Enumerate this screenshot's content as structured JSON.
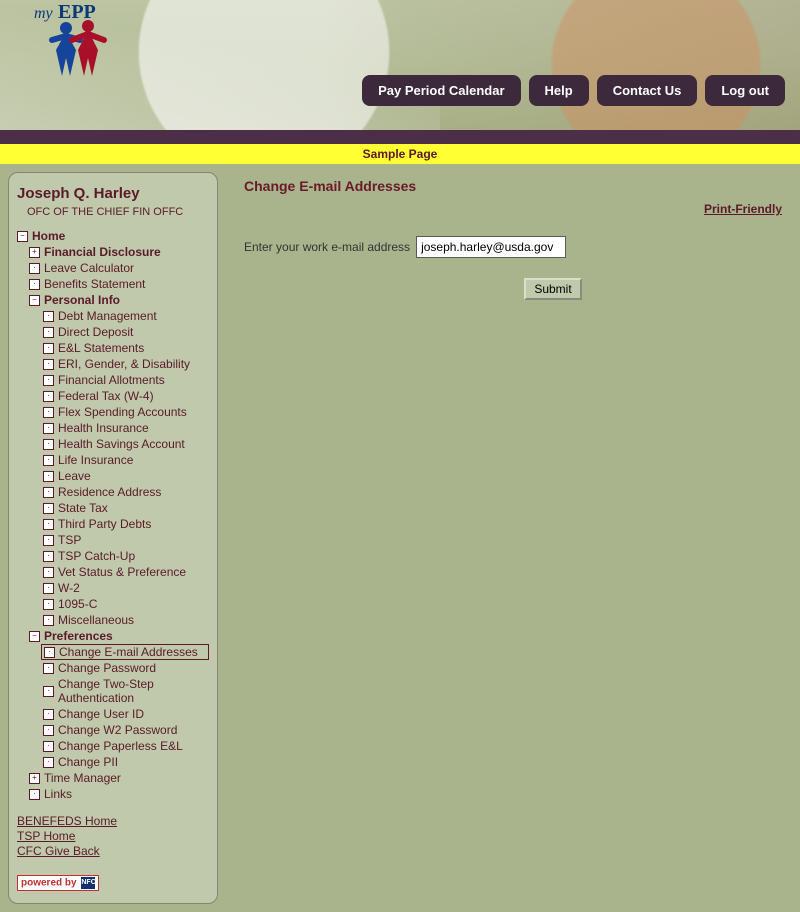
{
  "brand": {
    "prefix": "my",
    "suffix": "EPP"
  },
  "topnav": {
    "pay_period": "Pay Period Calendar",
    "help": "Help",
    "contact": "Contact Us",
    "logout": "Log out"
  },
  "subheader": "Sample Page",
  "sidebar": {
    "user_name": "Joseph Q. Harley",
    "user_org": "OFC OF THE CHIEF FIN OFFC",
    "home_label": "Home",
    "financial_disclosure": "Financial Disclosure",
    "leave_calculator": "Leave Calculator",
    "benefits_statement": "Benefits Statement",
    "personal_info": "Personal Info",
    "pi": {
      "debt_management": "Debt Management",
      "direct_deposit": "Direct Deposit",
      "el_statements": "E&L Statements",
      "eri": "ERI, Gender, & Disability",
      "fin_allotments": "Financial Allotments",
      "fed_tax": "Federal Tax (W-4)",
      "flex_spending": "Flex Spending Accounts",
      "health_ins": "Health Insurance",
      "hsa": "Health Savings Account",
      "life_ins": "Life Insurance",
      "leave": "Leave",
      "residence": "Residence Address",
      "state_tax": "State Tax",
      "third_party": "Third Party Debts",
      "tsp": "TSP",
      "tsp_catchup": "TSP Catch-Up",
      "vet_status": "Vet Status & Preference",
      "w2": "W-2",
      "c1095": "1095-C",
      "misc": "Miscellaneous"
    },
    "preferences": "Preferences",
    "pref": {
      "change_email": "Change E-mail Addresses",
      "change_password": "Change Password",
      "change_2fa": "Change Two-Step Authentication",
      "change_userid": "Change User ID",
      "change_w2pw": "Change W2 Password",
      "change_paperless": "Change Paperless E&L",
      "change_pii": "Change PII"
    },
    "time_manager": "Time Manager",
    "links": "Links",
    "bottom": {
      "benefeds": "BENEFEDS Home",
      "tsp_home": "TSP Home",
      "cfc": "CFC Give Back"
    },
    "powered_by": "powered by",
    "nfc_badge": "NFC"
  },
  "main": {
    "title": "Change E-mail Addresses",
    "print_friendly": "Print-Friendly",
    "email_label": "Enter your work e-mail address",
    "email_value": "joseph.harley@usda.gov",
    "submit": "Submit"
  }
}
